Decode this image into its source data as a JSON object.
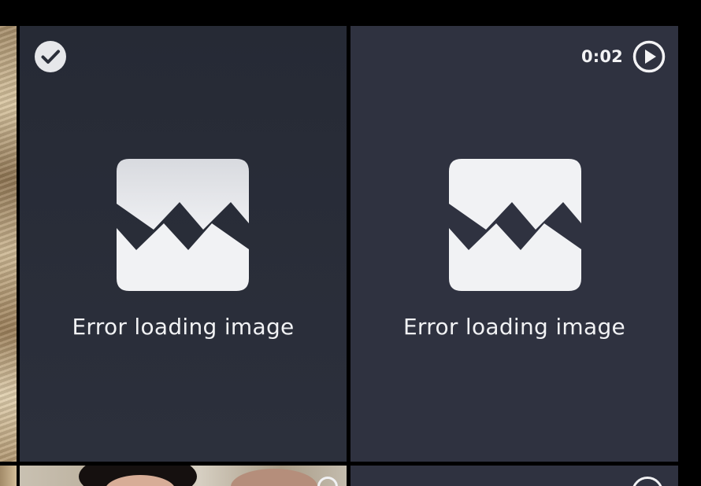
{
  "gallery": {
    "tiles": [
      {
        "error_text": "Error loading image",
        "selected": true
      },
      {
        "error_text": "Error loading image",
        "duration": "0:02",
        "is_video": true
      }
    ]
  },
  "icons": {
    "selected": "check-circle-icon",
    "play": "play-circle-icon",
    "broken_image": "broken-image-icon"
  },
  "colors": {
    "background": "#000000",
    "tile_background": "#2f3240",
    "icon_foreground": "#f1f2f4"
  }
}
